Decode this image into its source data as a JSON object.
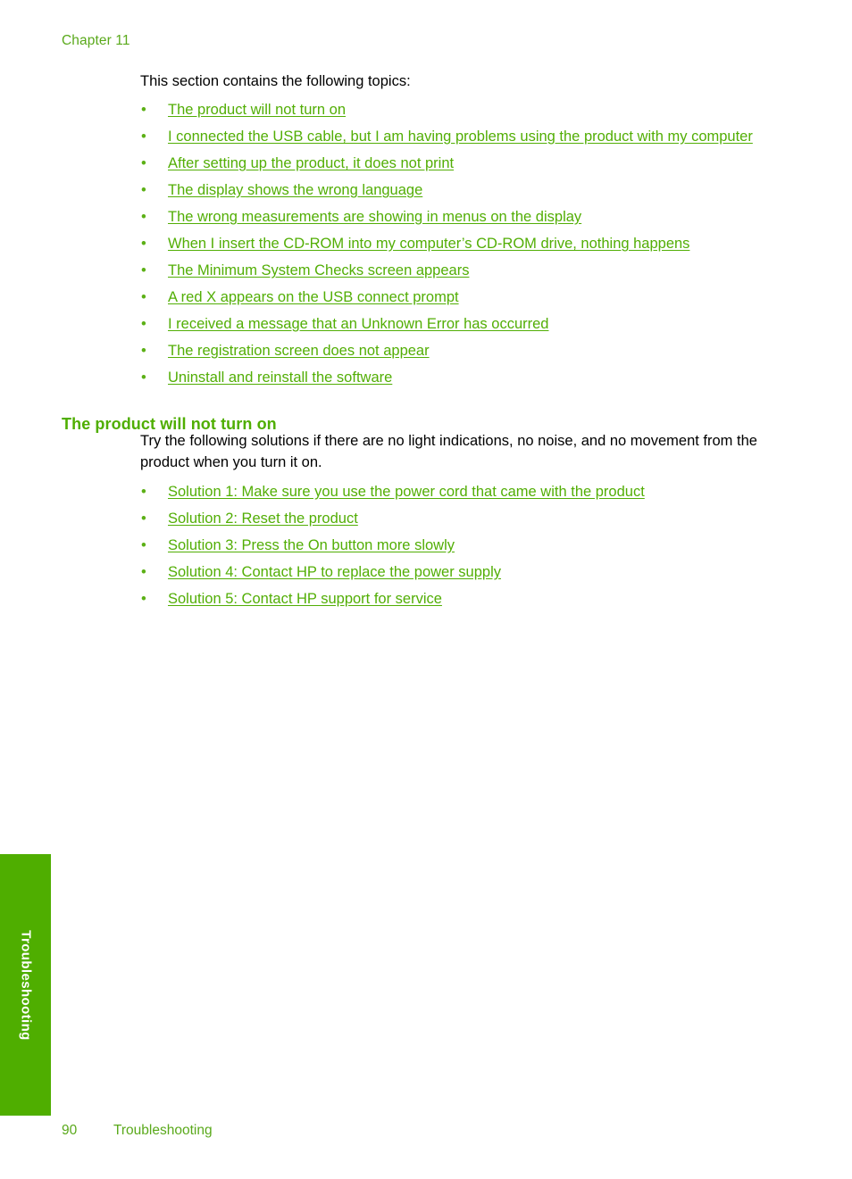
{
  "header": {
    "chapter_label": "Chapter 11"
  },
  "colors": {
    "link_green": "#52ae05",
    "heading_green": "#4fae00",
    "tab_green": "#4fae00",
    "header_green": "#5aa91b",
    "body_black": "#000000",
    "tab_text_white": "#ffffff"
  },
  "main": {
    "intro_text": "This section contains the following topics:",
    "topic_links": [
      {
        "label": "The product will not turn on"
      },
      {
        "label": "I connected the USB cable, but I am having problems using the product with my computer"
      },
      {
        "label": "After setting up the product, it does not print"
      },
      {
        "label": "The display shows the wrong language"
      },
      {
        "label": "The wrong measurements are showing in menus on the display"
      },
      {
        "label": "When I insert the CD-ROM into my computer’s CD-ROM drive, nothing happens"
      },
      {
        "label": "The Minimum System Checks screen appears"
      },
      {
        "label": "A red X appears on the USB connect prompt"
      },
      {
        "label": "I received a message that an Unknown Error has occurred"
      },
      {
        "label": "The registration screen does not appear"
      },
      {
        "label": "Uninstall and reinstall the software"
      }
    ],
    "section": {
      "heading": "The product will not turn on",
      "paragraph": "Try the following solutions if there are no light indications, no noise, and no movement from the product when you turn it on.",
      "solution_links": [
        {
          "label": "Solution 1: Make sure you use the power cord that came with the product"
        },
        {
          "label": "Solution 2: Reset the product"
        },
        {
          "label": "Solution 3: Press the On button more slowly"
        },
        {
          "label": "Solution 4: Contact HP to replace the power supply"
        },
        {
          "label": "Solution 5: Contact HP support for service"
        }
      ]
    }
  },
  "side_tab": {
    "label": "Troubleshooting"
  },
  "footer": {
    "page_number": "90",
    "section_title": "Troubleshooting"
  },
  "bullet_glyph": "•"
}
